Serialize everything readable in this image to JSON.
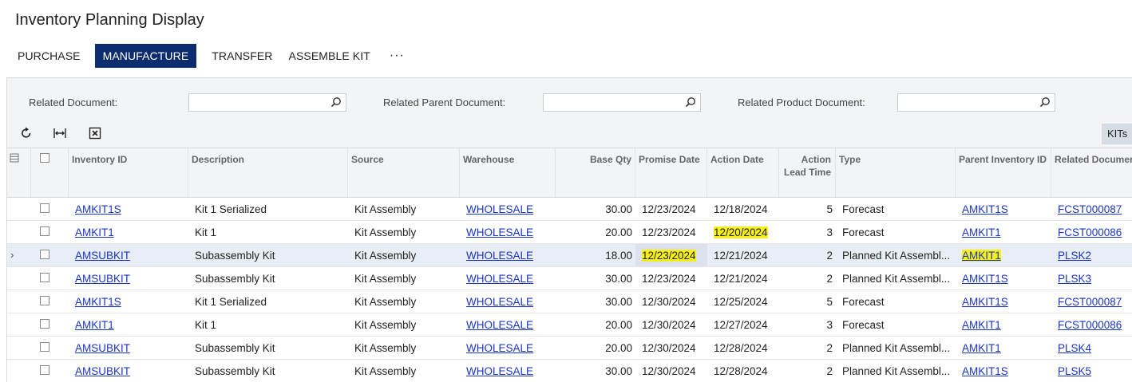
{
  "page": {
    "title": "Inventory Planning Display"
  },
  "toolbar": {
    "purchase": "PURCHASE",
    "manufacture": "MANUFACTURE",
    "transfer": "TRANSFER",
    "assemble_kit": "ASSEMBLE KIT",
    "more": "···"
  },
  "filters": {
    "related_document": "Related Document:",
    "related_parent_document": "Related Parent Document:",
    "related_product_document": "Related Product Document:"
  },
  "grid_tools": {
    "kits_label": "KITs"
  },
  "columns": {
    "inventory_id": "Inventory ID",
    "description": "Description",
    "source": "Source",
    "warehouse": "Warehouse",
    "base_qty": "Base Qty",
    "promise_date": "Promise Date",
    "action_date": "Action Date",
    "action_lead_time": "Action Lead Time",
    "type": "Type",
    "parent_inventory_id": "Parent Inventory ID",
    "related_document": "Related Document"
  },
  "rows": [
    {
      "inventory_id": "AMKIT1S",
      "description": "Kit 1 Serialized",
      "source": "Kit Assembly",
      "warehouse": "WHOLESALE",
      "base_qty": "30.00",
      "promise_date": "12/23/2024",
      "action_date": "12/18/2024",
      "lead_time": "5",
      "type": "Forecast",
      "parent_id": "AMKIT1S",
      "related_doc": "FCST000087"
    },
    {
      "inventory_id": "AMKIT1",
      "description": "Kit 1",
      "source": "Kit Assembly",
      "warehouse": "WHOLESALE",
      "base_qty": "20.00",
      "promise_date": "12/23/2024",
      "action_date": "12/20/2024",
      "lead_time": "3",
      "type": "Forecast",
      "parent_id": "AMKIT1",
      "related_doc": "FCST000086"
    },
    {
      "inventory_id": "AMSUBKIT",
      "description": "Subassembly Kit",
      "source": "Kit Assembly",
      "warehouse": "WHOLESALE",
      "base_qty": "18.00",
      "promise_date": "12/23/2024",
      "action_date": "12/21/2024",
      "lead_time": "2",
      "type": "Planned Kit Assembl...",
      "parent_id": "AMKIT1",
      "related_doc": "PLSK2"
    },
    {
      "inventory_id": "AMSUBKIT",
      "description": "Subassembly Kit",
      "source": "Kit Assembly",
      "warehouse": "WHOLESALE",
      "base_qty": "30.00",
      "promise_date": "12/23/2024",
      "action_date": "12/21/2024",
      "lead_time": "2",
      "type": "Planned Kit Assembl...",
      "parent_id": "AMKIT1S",
      "related_doc": "PLSK3"
    },
    {
      "inventory_id": "AMKIT1S",
      "description": "Kit 1 Serialized",
      "source": "Kit Assembly",
      "warehouse": "WHOLESALE",
      "base_qty": "30.00",
      "promise_date": "12/30/2024",
      "action_date": "12/25/2024",
      "lead_time": "5",
      "type": "Forecast",
      "parent_id": "AMKIT1S",
      "related_doc": "FCST000087"
    },
    {
      "inventory_id": "AMKIT1",
      "description": "Kit 1",
      "source": "Kit Assembly",
      "warehouse": "WHOLESALE",
      "base_qty": "20.00",
      "promise_date": "12/30/2024",
      "action_date": "12/27/2024",
      "lead_time": "3",
      "type": "Forecast",
      "parent_id": "AMKIT1",
      "related_doc": "FCST000086"
    },
    {
      "inventory_id": "AMSUBKIT",
      "description": "Subassembly Kit",
      "source": "Kit Assembly",
      "warehouse": "WHOLESALE",
      "base_qty": "20.00",
      "promise_date": "12/30/2024",
      "action_date": "12/28/2024",
      "lead_time": "2",
      "type": "Planned Kit Assembl...",
      "parent_id": "AMKIT1",
      "related_doc": "PLSK4"
    },
    {
      "inventory_id": "AMSUBKIT",
      "description": "Subassembly Kit",
      "source": "Kit Assembly",
      "warehouse": "WHOLESALE",
      "base_qty": "30.00",
      "promise_date": "12/30/2024",
      "action_date": "12/28/2024",
      "lead_time": "2",
      "type": "Planned Kit Assembl...",
      "parent_id": "AMKIT1S",
      "related_doc": "PLSK5"
    }
  ],
  "highlights": {
    "color": "#f6ef1a",
    "cells": [
      "1.action_date",
      "2.promise_date",
      "2.parent_id"
    ]
  },
  "selected_row": 2,
  "colors": {
    "accent": "#0c2c6e",
    "link": "#1a35c4"
  }
}
